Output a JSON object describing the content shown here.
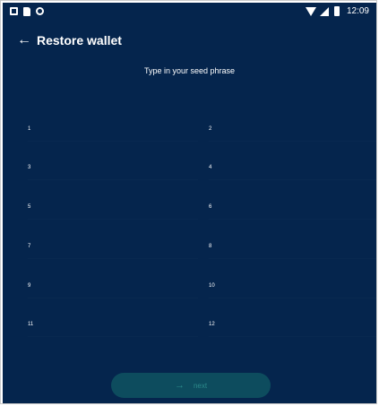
{
  "status_bar": {
    "time": "12:09",
    "left_icons": [
      "notification-icon",
      "sd-card-icon",
      "sync-icon"
    ],
    "right_icons": [
      "wifi-icon",
      "signal-icon",
      "battery-icon"
    ]
  },
  "app_bar": {
    "back_icon": "arrow-left-icon",
    "back_glyph": "←",
    "title": "Restore wallet"
  },
  "instructions": "Type in your seed phrase",
  "seed_words": [
    {
      "number": "1",
      "value": ""
    },
    {
      "number": "2",
      "value": ""
    },
    {
      "number": "3",
      "value": ""
    },
    {
      "number": "4",
      "value": ""
    },
    {
      "number": "5",
      "value": ""
    },
    {
      "number": "6",
      "value": ""
    },
    {
      "number": "7",
      "value": ""
    },
    {
      "number": "8",
      "value": ""
    },
    {
      "number": "9",
      "value": ""
    },
    {
      "number": "10",
      "value": ""
    },
    {
      "number": "11",
      "value": ""
    },
    {
      "number": "12",
      "value": ""
    }
  ],
  "next_button": {
    "icon": "arrow-right-icon",
    "glyph": "→",
    "label": "next",
    "enabled": false
  },
  "colors": {
    "background": "#05254d",
    "button_disabled": "#0d4c5e",
    "button_text_disabled": "#2b8a8a",
    "text": "#ffffff"
  }
}
